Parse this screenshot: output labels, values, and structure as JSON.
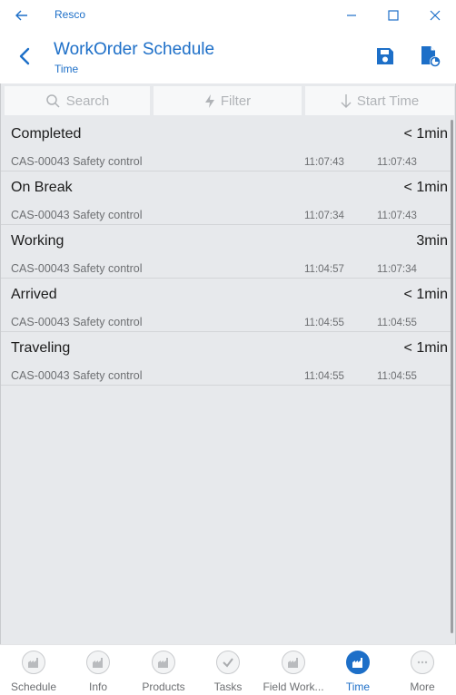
{
  "window": {
    "title": "Resco"
  },
  "header": {
    "title": "WorkOrder Schedule",
    "subtitle": "Time"
  },
  "toolbar": {
    "search_label": "Search",
    "filter_label": "Filter",
    "sort_label": "Start Time"
  },
  "rows": [
    {
      "title": "Completed",
      "duration": "< 1min",
      "desc": "CAS-00043 Safety control",
      "t1": "11:07:43",
      "t2": "11:07:43"
    },
    {
      "title": "On Break",
      "duration": "< 1min",
      "desc": "CAS-00043 Safety control",
      "t1": "11:07:34",
      "t2": "11:07:43"
    },
    {
      "title": "Working",
      "duration": "3min",
      "desc": "CAS-00043 Safety control",
      "t1": "11:04:57",
      "t2": "11:07:34"
    },
    {
      "title": "Arrived",
      "duration": "< 1min",
      "desc": "CAS-00043 Safety control",
      "t1": "11:04:55",
      "t2": "11:04:55"
    },
    {
      "title": "Traveling",
      "duration": "< 1min",
      "desc": "CAS-00043 Safety control",
      "t1": "11:04:55",
      "t2": "11:04:55"
    }
  ],
  "nav": [
    {
      "label": "Schedule",
      "icon": "factory-icon",
      "active": false
    },
    {
      "label": "Info",
      "icon": "factory-icon",
      "active": false
    },
    {
      "label": "Products",
      "icon": "factory-icon",
      "active": false
    },
    {
      "label": "Tasks",
      "icon": "checkmark-icon",
      "active": false
    },
    {
      "label": "Field Work...",
      "icon": "factory-icon",
      "active": false
    },
    {
      "label": "Time",
      "icon": "factory-icon",
      "active": true
    },
    {
      "label": "More",
      "icon": "more-icon",
      "active": false
    }
  ],
  "colors": {
    "accent": "#1d6fc8",
    "content_bg": "#e7e9ec",
    "muted_text": "#6d6f72"
  }
}
